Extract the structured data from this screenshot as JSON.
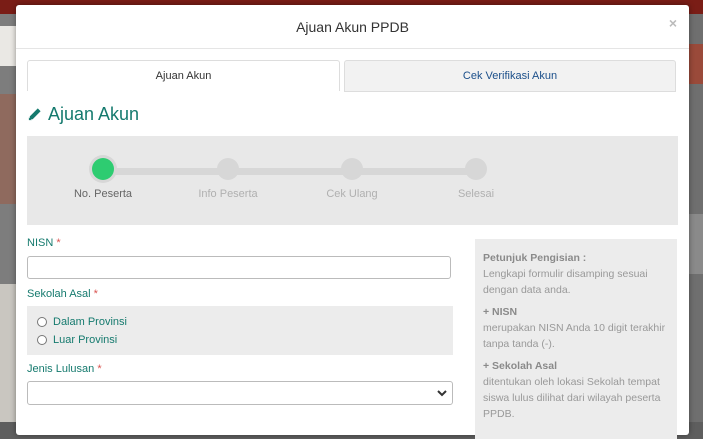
{
  "modal": {
    "title": "Ajuan Akun PPDB",
    "close_symbol": "×"
  },
  "tabs": [
    {
      "label": "Ajuan Akun",
      "active": true
    },
    {
      "label": "Cek Verifikasi Akun",
      "active": false
    }
  ],
  "section": {
    "icon": "pencil-icon",
    "title": "Ajuan Akun"
  },
  "stepper": {
    "steps": [
      {
        "label": "No. Peserta",
        "active": true
      },
      {
        "label": "Info Peserta",
        "active": false
      },
      {
        "label": "Cek Ulang",
        "active": false
      },
      {
        "label": "Selesai",
        "active": false
      }
    ]
  },
  "form": {
    "nisn_label": "NISN",
    "required_mark": "*",
    "nisn_value": "",
    "sekolah_label": "Sekolah Asal",
    "sekolah_options": [
      "Dalam Provinsi",
      "Luar Provinsi"
    ],
    "jenis_label": "Jenis Lulusan",
    "jenis_value": ""
  },
  "help": {
    "title": "Petunjuk Pengisian :",
    "intro": "Lengkapi formulir disamping sesuai dengan data anda.",
    "nisn_heading": "+ NISN",
    "nisn_text": "merupakan NISN Anda 10 digit terakhir tanpa tanda (-).",
    "sekolah_heading": "+ Sekolah Asal",
    "sekolah_text": "ditentukan oleh lokasi Sekolah tempat siswa lulus dilihat dari wilayah peserta PPDB."
  },
  "colors": {
    "accent": "#157a6e",
    "step_active": "#2ecc71",
    "required": "#d9534f"
  }
}
